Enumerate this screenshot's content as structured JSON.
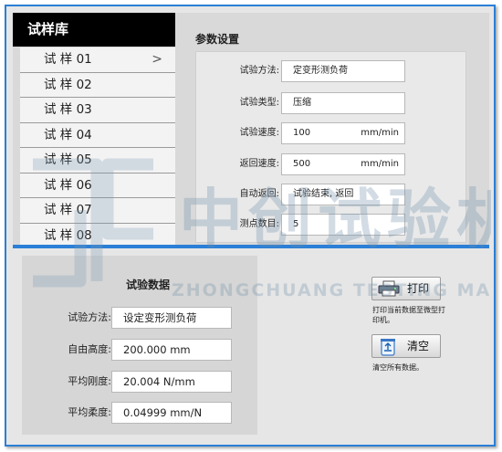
{
  "library": {
    "title": "试样库",
    "items": [
      "试 样 01",
      "试 样 02",
      "试 样 03",
      "试 样 04",
      "试 样 05",
      "试 样 06",
      "试 样 07",
      "试 样 08"
    ],
    "chevron": ">"
  },
  "params": {
    "title": "参数设置",
    "rows": [
      {
        "label": "试验方法:",
        "value": "定变形测负荷",
        "unit": ""
      },
      {
        "label": "试验类型:",
        "value": "压缩",
        "unit": ""
      },
      {
        "label": "试验速度:",
        "value": "100",
        "unit": "mm/min"
      },
      {
        "label": "返回速度:",
        "value": "500",
        "unit": "mm/min"
      },
      {
        "label": "自动返回:",
        "value": "试验结束, 返回",
        "unit": ""
      },
      {
        "label": "测点数目:",
        "value": "5",
        "unit": ""
      }
    ]
  },
  "test_data": {
    "title": "试验数据",
    "rows": [
      {
        "label": "试验方法:",
        "value": "设定变形测负荷"
      },
      {
        "label": "自由高度:",
        "value": "200.000 mm"
      },
      {
        "label": "平均刚度:",
        "value": "20.004 N/mm"
      },
      {
        "label": "平均柔度:",
        "value": "0.04999 mm/N"
      }
    ]
  },
  "actions": {
    "print_label": "打印",
    "print_note": "打印当前数据至微型打印机。",
    "clear_label": "清空",
    "clear_note": "清空所有数据。"
  },
  "watermark": {
    "text": "中创试验机",
    "subtext": "ZHONGCHUANG TESTING MACHINE"
  },
  "colors": {
    "accent": "#2b7fd6",
    "header_bg": "#000000",
    "panel_bg": "#d9d9d9"
  },
  "icons": [
    "chevron-right-icon",
    "printer-icon",
    "recycle-bin-icon"
  ]
}
